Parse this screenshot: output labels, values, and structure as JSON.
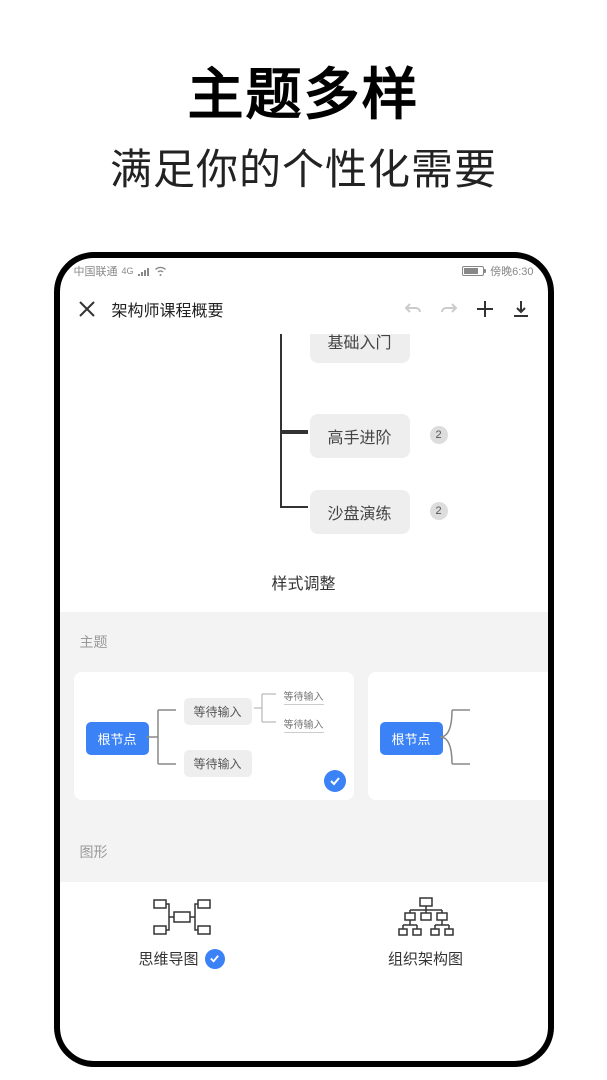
{
  "hero": {
    "title": "主题多样",
    "subtitle": "满足你的个性化需要"
  },
  "status": {
    "carrier": "中国联通",
    "net": "4G",
    "time": "傍晚6:30"
  },
  "toolbar": {
    "title": "架构师课程概要"
  },
  "mindmap": {
    "node1": "基础入门",
    "node2": "高手进阶",
    "node3": "沙盘演练",
    "badge": "2"
  },
  "panel": {
    "title": "样式调整",
    "section_theme": "主题",
    "section_shape": "图形"
  },
  "theme_card": {
    "root": "根节点",
    "sub": "等待输入",
    "leaf": "等待输入"
  },
  "shapes": {
    "mindmap": "思维导图",
    "org": "组织架构图"
  }
}
